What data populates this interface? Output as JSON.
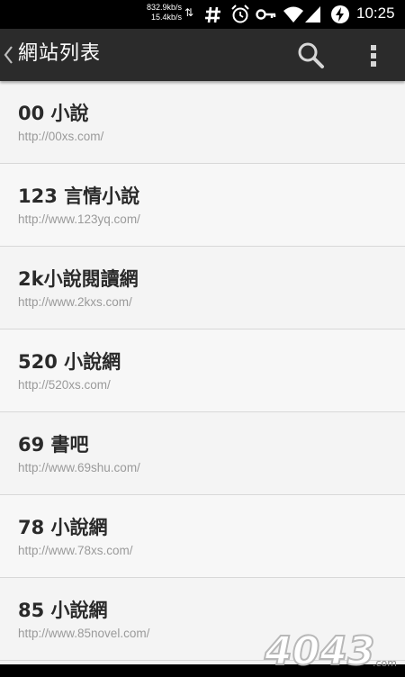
{
  "status_bar": {
    "download_speed": "832.9kb/s",
    "upload_speed": "15.4kb/s",
    "arrows": "⇅",
    "icons": [
      "hash-icon",
      "alarm-icon",
      "key-icon",
      "wifi-icon",
      "signal-icon",
      "battery-charging-icon"
    ],
    "time": "10:25"
  },
  "action_bar": {
    "title": "網站列表",
    "back_icon": "chevron-left-icon",
    "search_icon": "search-icon",
    "overflow_icon": "more-vertical-icon",
    "background": "#2b2b2b"
  },
  "sites": [
    {
      "name": "00 小說",
      "url": "http://00xs.com/"
    },
    {
      "name": "123 言情小說",
      "url": "http://www.123yq.com/"
    },
    {
      "name": "2k小說閱讀網",
      "url": "http://www.2kxs.com/"
    },
    {
      "name": "520 小說網",
      "url": "http://520xs.com/"
    },
    {
      "name": "69 書吧",
      "url": "http://www.69shu.com/"
    },
    {
      "name": "78 小說網",
      "url": "http://www.78xs.com/"
    },
    {
      "name": "85 小說網",
      "url": "http://www.85novel.com/"
    }
  ],
  "watermark": {
    "text": "4043",
    "suffix": ".com"
  }
}
